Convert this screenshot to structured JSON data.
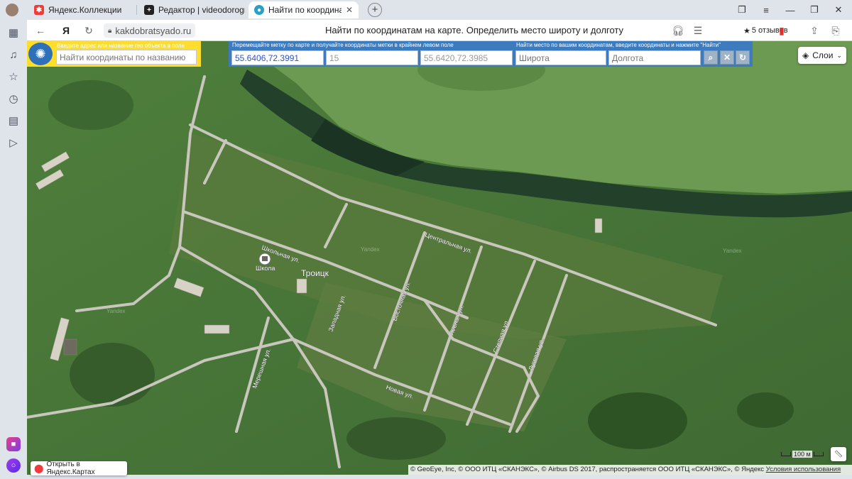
{
  "tabs": [
    {
      "title": "Яндекс.Коллекции",
      "icon": "yandex-collections-icon",
      "color": "#f33a3a"
    },
    {
      "title": "Редактор | videodorogro:",
      "icon": "plus-icon",
      "color": "#222222"
    },
    {
      "title": "Найти по координатам",
      "icon": "site-favicon",
      "color": "#2aa0c8",
      "active": true,
      "close": "✕"
    }
  ],
  "new_tab": "+",
  "address_bar": {
    "yandex_button": "Я",
    "url": "kakdobratsyado.ru",
    "page_title": "Найти по координатам на карте. Определить место широту и долготу",
    "reviews": "5 отзывов"
  },
  "map_ui": {
    "name_search": {
      "hint": "Введите адрес или название гео объекта в поле",
      "placeholder": "Найти координаты по названию"
    },
    "marker_coords": {
      "hint": "Перемещайте метку по карте и получайте координаты метки в крайнем левом поле",
      "value": "55.6406,72.3991",
      "zoom": "15",
      "corner": "55.6420,72.3985"
    },
    "find_by_coords": {
      "hint": "Найти место по вашим координатам, введите координаты и нажмите \"Найти\"",
      "lat_placeholder": "Широта",
      "lon_placeholder": "Долгота"
    },
    "layers_label": "Слои",
    "open_in_maps": "Открыть в Яндекс.Картах",
    "scale": "100 м",
    "copyright": "© GeoEye, Inc, © ООО ИТЦ «СКАНЭКС», © Airbus DS 2017, распространяется ООО ИТЦ «СКАНЭКС», © Яндекс",
    "terms_link": "Условия использования"
  },
  "map_labels": {
    "village": "Троицк",
    "school": "Школа",
    "streets": [
      "Центральная ул.",
      "Школьная ул.",
      "Новая ул.",
      "Мерешная ул.",
      "Восточная ул.",
      "Западная ул.",
      "Лесная ул.",
      "Степная ул.",
      "Луговая ул."
    ],
    "watermark": "Yandex"
  },
  "colors": {
    "yellow_panel": "#ffdd2d",
    "blue_panel": "#3d7bbf",
    "coord_value_text": "#2b55c7",
    "terrain": "#4d7a3a"
  }
}
